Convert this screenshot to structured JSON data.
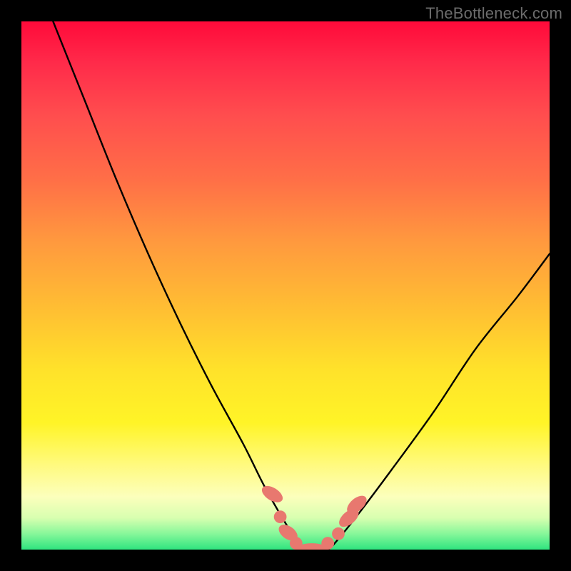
{
  "watermark": {
    "text": "TheBottleneck.com"
  },
  "chart_data": {
    "type": "line",
    "title": "",
    "xlabel": "",
    "ylabel": "",
    "xlim": [
      0,
      100
    ],
    "ylim": [
      0,
      100
    ],
    "grid": false,
    "legend": false,
    "series": [
      {
        "name": "bottleneck-curve",
        "x": [
          6,
          12,
          18,
          24,
          30,
          36,
          42,
          46,
          50,
          52,
          54,
          56,
          58,
          60,
          64,
          70,
          78,
          86,
          94,
          100
        ],
        "values": [
          100,
          85,
          70,
          56,
          43,
          31,
          20,
          12,
          5,
          2,
          0,
          0,
          0,
          2,
          7,
          15,
          26,
          38,
          48,
          56
        ]
      }
    ],
    "markers": {
      "name": "valley-markers",
      "color": "#e8786f",
      "points": [
        {
          "x": 47.5,
          "y": 10.5,
          "rx": 1.2,
          "ry": 2.2,
          "rot": -58
        },
        {
          "x": 49.0,
          "y": 6.2,
          "rx": 1.2,
          "ry": 1.2,
          "rot": 0
        },
        {
          "x": 50.5,
          "y": 3.2,
          "rx": 1.2,
          "ry": 2.0,
          "rot": -55
        },
        {
          "x": 52.0,
          "y": 1.2,
          "rx": 1.2,
          "ry": 1.2,
          "rot": 0
        },
        {
          "x": 55.0,
          "y": 0.0,
          "rx": 3.0,
          "ry": 1.2,
          "rot": 0
        },
        {
          "x": 58.0,
          "y": 1.2,
          "rx": 1.2,
          "ry": 1.2,
          "rot": 0
        },
        {
          "x": 60.0,
          "y": 3.0,
          "rx": 1.2,
          "ry": 1.2,
          "rot": 0
        },
        {
          "x": 62.0,
          "y": 6.0,
          "rx": 1.2,
          "ry": 2.2,
          "rot": 50
        },
        {
          "x": 63.5,
          "y": 8.5,
          "rx": 1.2,
          "ry": 2.2,
          "rot": 50
        }
      ]
    }
  }
}
